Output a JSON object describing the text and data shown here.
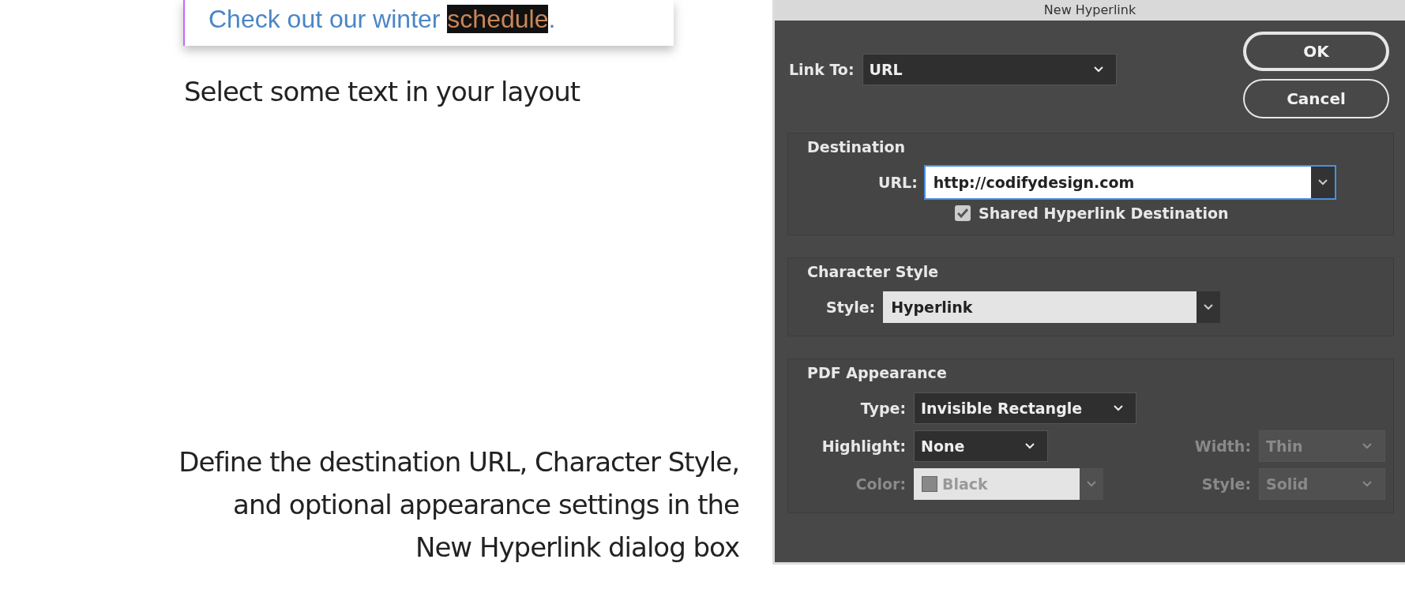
{
  "layout_sample": {
    "segments": [
      {
        "text": "Check out our winter ",
        "selected": false
      },
      {
        "text": "schedule",
        "selected": true
      },
      {
        "text": ".",
        "selected": false
      }
    ]
  },
  "captions": [
    "Select some text in your layout",
    "Define the destination URL, Character Style, and optional appearance settings in the New Hyperlink dialog box"
  ],
  "dialog": {
    "title": "New Hyperlink",
    "link_to": {
      "label": "Link To:",
      "value": "URL"
    },
    "buttons": [
      {
        "label": "OK",
        "kind": "default"
      },
      {
        "label": "Cancel",
        "kind": "cancel"
      }
    ],
    "destination": {
      "title": "Destination",
      "url": {
        "label": "URL:",
        "value": "http://codifydesign.com",
        "focused": true
      },
      "shared": {
        "label": "Shared Hyperlink Destination",
        "checked": true
      }
    },
    "character_style": {
      "title": "Character Style",
      "style": {
        "label": "Style:",
        "value": "Hyperlink"
      }
    },
    "pdf_appearance": {
      "title": "PDF Appearance",
      "type": {
        "label": "Type:",
        "value": "Invisible Rectangle",
        "disabled": false
      },
      "highlight": {
        "label": "Highlight:",
        "value": "None",
        "disabled": false
      },
      "width": {
        "label": "Width:",
        "value": "Thin",
        "disabled": true
      },
      "color": {
        "label": "Color:",
        "value": "Black",
        "disabled": true
      },
      "style": {
        "label": "Style:",
        "value": "Solid",
        "disabled": true
      }
    }
  }
}
